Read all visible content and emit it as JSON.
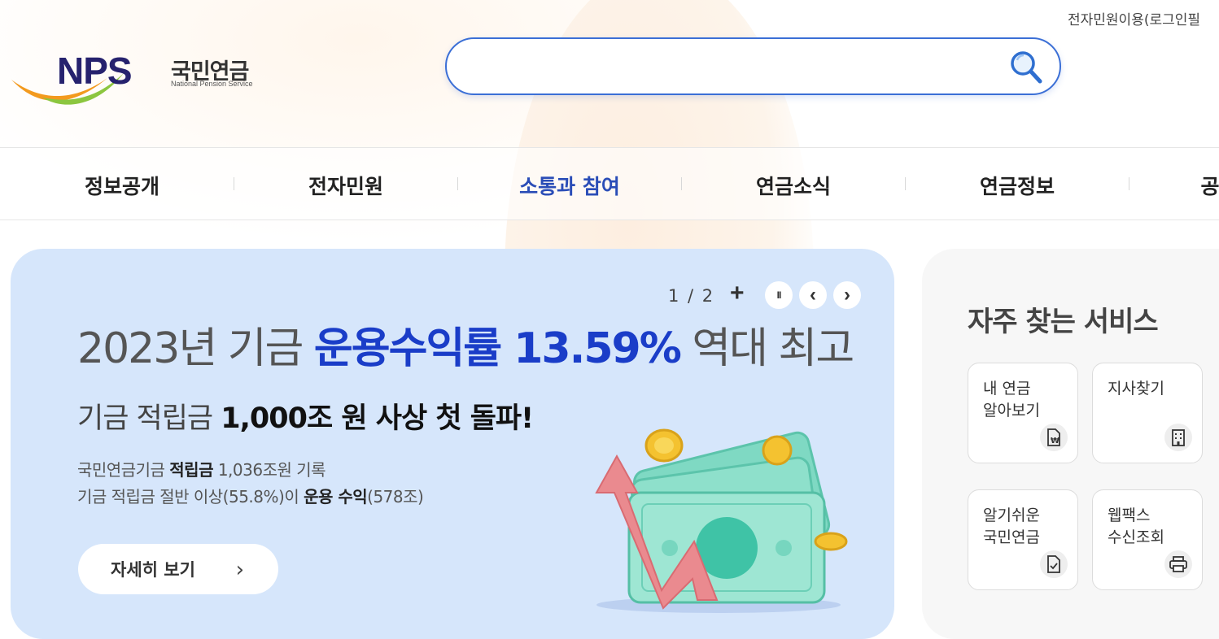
{
  "header": {
    "util_link": "전자민원이용(로그인필",
    "logo_text": "NPS",
    "logo_korean": "국민연금",
    "logo_english": "National Pension Service",
    "search_placeholder": ""
  },
  "gnb": {
    "items": [
      {
        "label": "정보공개"
      },
      {
        "label": "전자민원"
      },
      {
        "label": "소통과 참여"
      },
      {
        "label": "연금소식"
      },
      {
        "label": "연금정보"
      },
      {
        "label": "공"
      }
    ],
    "active_index": 2
  },
  "banner": {
    "page_indicator": "1 / 2",
    "plus_label": "+",
    "pause_label": "II",
    "prev_label": "‹",
    "next_label": "›",
    "title_prefix": "2023년 기금 ",
    "title_highlight": "운용수익률 13.59%",
    "title_suffix": " 역대 최고",
    "sub_prefix": "기금 적립금 ",
    "sub_bold": "1,000조 원 사상 첫 돌파!",
    "desc_line1_prefix": "국민연금기금 ",
    "desc_line1_bold": "적립금",
    "desc_line1_suffix": " 1,036조원 기록",
    "desc_line2_prefix": "기금 적립금 절반 이상(55.8%)이 ",
    "desc_line2_bold": "운용 수익",
    "desc_line2_suffix": "(578조)",
    "more_label": "자세히 보기",
    "more_arrow": "›",
    "bg_color": "#d6e6fb",
    "highlight_color": "#1a3dc8"
  },
  "services": {
    "title": "자주 찾는 서비스",
    "cards": [
      {
        "label": "내 연금\n알아보기",
        "icon": "document-won-icon"
      },
      {
        "label": "지사찾기",
        "icon": "building-icon"
      },
      {
        "label": "알기쉬운\n국민연금",
        "icon": "document-check-icon"
      },
      {
        "label": "웹팩스\n수신조회",
        "icon": "printer-icon"
      }
    ]
  },
  "colors": {
    "accent": "#3b6fd6",
    "nav_active": "#2a4db7",
    "logo_navy": "#26226e"
  }
}
